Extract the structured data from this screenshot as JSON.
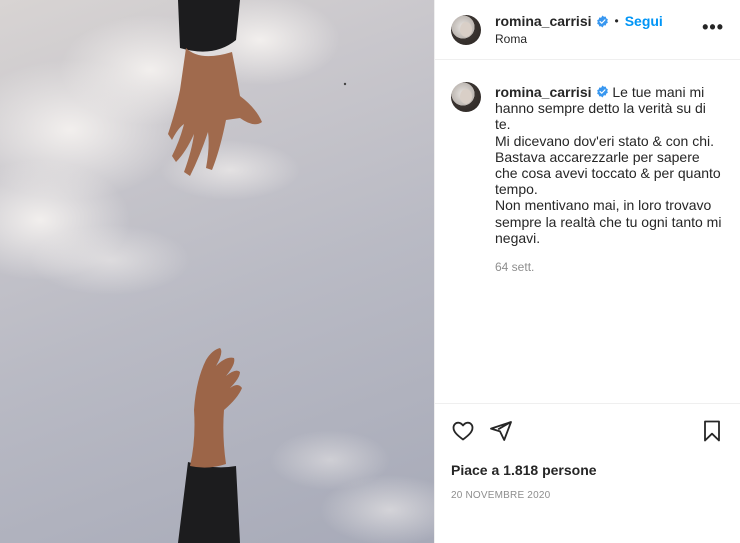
{
  "post": {
    "username": "romina_carrisi",
    "follow_label": "Segui",
    "separator": "•",
    "location": "Roma",
    "more_label": "•••"
  },
  "caption": {
    "username": "romina_carrisi",
    "text": "Le tue mani mi hanno sempre detto la verità su di te.\nMi dicevano dov'eri stato & con chi.\nBastava accarezzarle per sapere che cosa avevi toccato & per quanto tempo.\nNon mentivano mai, in loro trovavo sempre la realtà che tu ogni tanto mi negavi.",
    "time": "64 sett."
  },
  "footer": {
    "likes": "Piace a 1.818 persone",
    "date": "20 NOVEMBRE 2020"
  },
  "colors": {
    "link": "#0095f6",
    "verified": "#3897f0",
    "muted": "#8e8e8e"
  },
  "icons": [
    "heart-icon",
    "share-icon",
    "bookmark-icon",
    "verified-icon",
    "more-icon"
  ]
}
